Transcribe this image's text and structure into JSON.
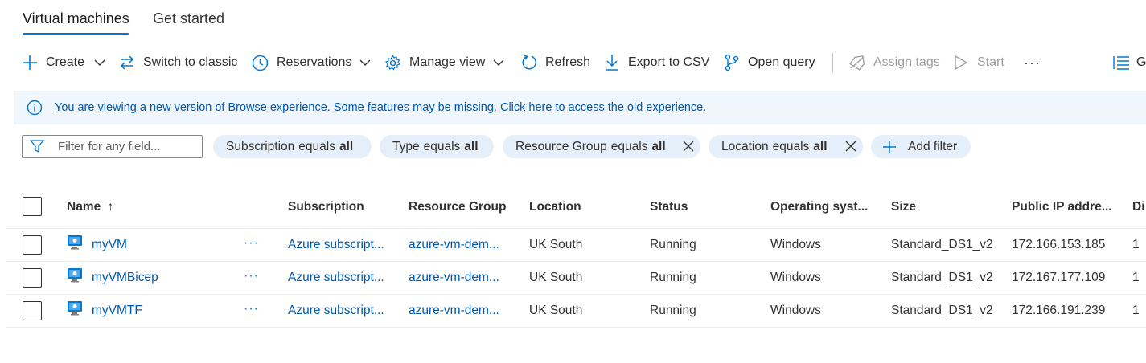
{
  "tabs": [
    {
      "label": "Virtual machines",
      "active": true
    },
    {
      "label": "Get started",
      "active": false
    }
  ],
  "toolbar": {
    "create": "Create",
    "switch_classic": "Switch to classic",
    "reservations": "Reservations",
    "manage_view": "Manage view",
    "refresh": "Refresh",
    "export_csv": "Export to CSV",
    "open_query": "Open query",
    "assign_tags": "Assign tags",
    "start": "Start",
    "overflow": "···",
    "group_by_partial": "G"
  },
  "banner": {
    "text": "You are viewing a new version of Browse experience. Some features may be missing. Click here to access the old experience."
  },
  "filter": {
    "placeholder": "Filter for any field...",
    "pills": [
      {
        "field": "Subscription",
        "op": "equals",
        "value": "all",
        "removable": false
      },
      {
        "field": "Type",
        "op": "equals",
        "value": "all",
        "removable": false
      },
      {
        "field": "Resource Group",
        "op": "equals",
        "value": "all",
        "removable": true
      },
      {
        "field": "Location",
        "op": "equals",
        "value": "all",
        "removable": true
      }
    ],
    "add_filter": "Add filter"
  },
  "table": {
    "columns": {
      "name": "Name",
      "name_sort": "↑",
      "subscription": "Subscription",
      "resource_group": "Resource Group",
      "location": "Location",
      "status": "Status",
      "os": "Operating syst...",
      "size": "Size",
      "public_ip": "Public IP addre...",
      "disks_partial": "Di"
    },
    "rows": [
      {
        "name": "myVM",
        "more": "···",
        "subscription": "Azure subscript...",
        "resource_group": "azure-vm-dem...",
        "location": "UK South",
        "status": "Running",
        "os": "Windows",
        "size": "Standard_DS1_v2",
        "public_ip": "172.166.153.185",
        "disks": "1"
      },
      {
        "name": "myVMBicep",
        "more": "···",
        "subscription": "Azure subscript...",
        "resource_group": "azure-vm-dem...",
        "location": "UK South",
        "status": "Running",
        "os": "Windows",
        "size": "Standard_DS1_v2",
        "public_ip": "172.167.177.109",
        "disks": "1"
      },
      {
        "name": "myVMTF",
        "more": "···",
        "subscription": "Azure subscript...",
        "resource_group": "azure-vm-dem...",
        "location": "UK South",
        "status": "Running",
        "os": "Windows",
        "size": "Standard_DS1_v2",
        "public_ip": "172.166.191.239",
        "disks": "1"
      }
    ]
  },
  "colors": {
    "accent": "#0078d4",
    "link": "#0058ad",
    "banner_bg": "#eff6fc",
    "pill_bg": "#e5eff9",
    "disabled": "#a19f9d"
  }
}
